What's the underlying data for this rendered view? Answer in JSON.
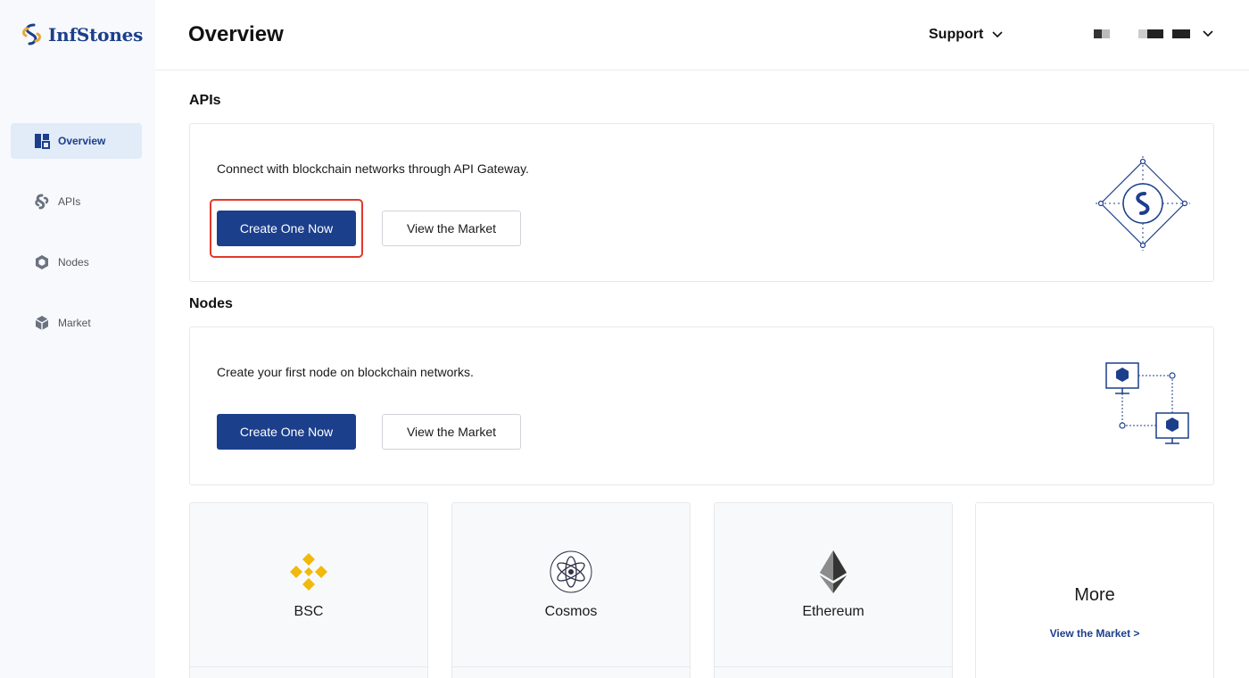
{
  "brand": {
    "name": "InfStones",
    "color": "#1c3f8c",
    "accent": "#e8a93b"
  },
  "sidebar": {
    "items": [
      {
        "label": "Overview",
        "icon": "dashboard-icon",
        "active": true
      },
      {
        "label": "APIs",
        "icon": "api-swirl-icon",
        "active": false
      },
      {
        "label": "Nodes",
        "icon": "node-hexagon-icon",
        "active": false
      },
      {
        "label": "Market",
        "icon": "market-cube-icon",
        "active": false
      }
    ]
  },
  "header": {
    "title": "Overview",
    "support_label": "Support"
  },
  "apis": {
    "section_title": "APIs",
    "description": "Connect with blockchain networks through API Gateway.",
    "primary_button": "Create One Now",
    "secondary_button": "View the Market"
  },
  "nodes": {
    "section_title": "Nodes",
    "description": "Create your first node on blockchain networks.",
    "primary_button": "Create One Now",
    "secondary_button": "View the Market"
  },
  "networks": [
    {
      "label": "BSC",
      "icon": "bsc-icon",
      "color": "#f0b90b"
    },
    {
      "label": "Cosmos",
      "icon": "cosmos-icon",
      "color": "#2e3148"
    },
    {
      "label": "Ethereum",
      "icon": "ethereum-icon",
      "color": "#343434"
    }
  ],
  "more_tile": {
    "label": "More",
    "link": "View the Market >"
  },
  "colors": {
    "primary": "#1c3f8c",
    "highlight": "#e0392b",
    "sidebar_bg": "#f7f9fc",
    "active_bg": "#e2ebf8"
  }
}
